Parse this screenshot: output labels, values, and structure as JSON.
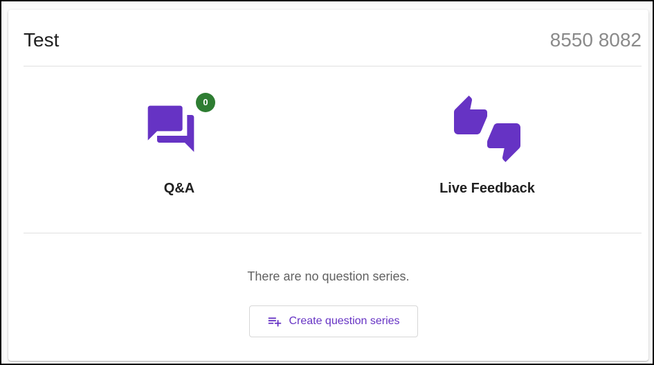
{
  "session": {
    "title": "Test",
    "meeting_id": "8550 8082"
  },
  "features": {
    "qa": {
      "label": "Q&A",
      "icon": "forum-icon",
      "badge_count": "0"
    },
    "live_feedback": {
      "label": "Live Feedback",
      "icon": "thumbs-up-down-icon"
    }
  },
  "question_series": {
    "empty_message": "There are no question series.",
    "create_label": "Create question series",
    "create_icon": "playlist-add-icon"
  },
  "colors": {
    "accent": "#6633c4",
    "badge": "#2e7d32"
  }
}
